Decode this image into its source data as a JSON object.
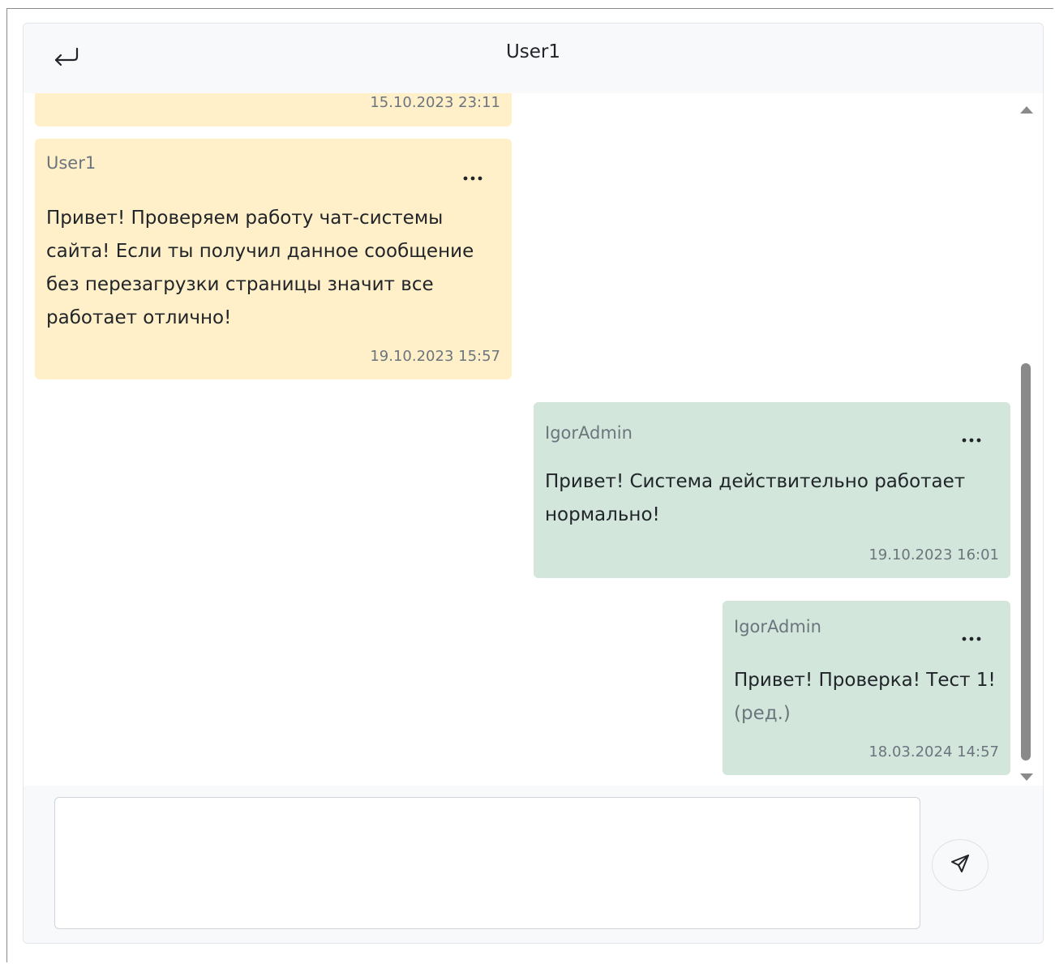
{
  "header": {
    "title": "User1",
    "back_icon": "return-arrow-icon"
  },
  "messages": [
    {
      "direction": "in",
      "author": "",
      "text": "",
      "time": "15.10.2023 23:11"
    },
    {
      "direction": "in",
      "author": "User1",
      "text_lines": [
        "Привет! Проверяем работу чат-системы",
        "сайта! Если ты получил данное сообщение",
        "без перезагрузки страницы значит все",
        "работает отлично!"
      ],
      "time": "19.10.2023 15:57"
    },
    {
      "direction": "out",
      "author": "IgorAdmin",
      "text_lines": [
        "Привет! Система действительно работает",
        "нормально!"
      ],
      "time": "19.10.2023 16:01"
    },
    {
      "direction": "out",
      "author": "IgorAdmin",
      "text_lines": [
        "Привет! Проверка! Тест 1!"
      ],
      "edited_label": "(ред.)",
      "time": "18.03.2024 14:57"
    }
  ],
  "composer": {
    "input_value": "",
    "input_placeholder": "",
    "send_icon": "paper-plane-icon"
  },
  "colors": {
    "incoming_bubble": "#fff0c9",
    "outgoing_bubble": "#d2e6dc",
    "header_bg": "#f8f9fa",
    "muted_text": "#6c757d"
  }
}
